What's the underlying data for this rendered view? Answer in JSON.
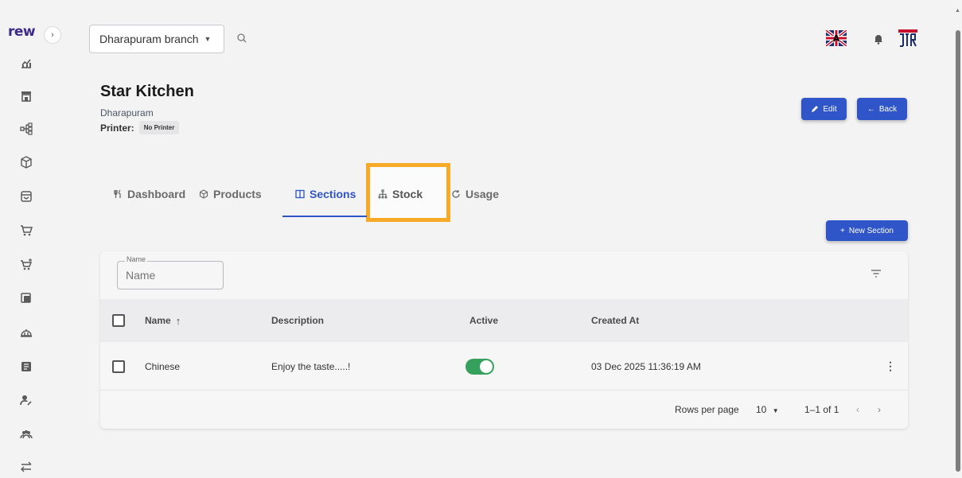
{
  "app": {
    "logo_text": "rew"
  },
  "topbar": {
    "branch": "Dharapuram branch"
  },
  "kitchen": {
    "title": "Star Kitchen",
    "subtitle": "Dharapuram",
    "printer_label": "Printer:",
    "printer_value": "No Printer"
  },
  "actions": {
    "edit_label": "Edit",
    "back_label": "Back",
    "new_section_label": "New Section"
  },
  "tabs": [
    {
      "label": "Dashboard",
      "icon": "utensils-icon",
      "active": false
    },
    {
      "label": "Products",
      "icon": "box-icon",
      "active": false
    },
    {
      "label": "Sections",
      "icon": "columns-icon",
      "active": true
    },
    {
      "label": "Stock",
      "icon": "hierarchy-icon",
      "active": false,
      "highlighted": true
    },
    {
      "label": "Usage",
      "icon": "refresh-icon",
      "active": false
    }
  ],
  "filter": {
    "name_label": "Name",
    "name_placeholder": "Name"
  },
  "table": {
    "columns": [
      "Name",
      "Description",
      "Active",
      "Created At"
    ],
    "sort_indicator": "↑",
    "rows": [
      {
        "name": "Chinese",
        "description": "Enjoy the taste.....!",
        "active": true,
        "created_at": "03 Dec 2025 11:36:19 AM"
      }
    ]
  },
  "pagination": {
    "rows_per_page_label": "Rows per page",
    "rows_per_page_value": "10",
    "range": "1–1 of 1"
  },
  "colors": {
    "primary": "#2f55c9",
    "toggle_on": "#35a15c",
    "highlight": "#f7a928"
  }
}
